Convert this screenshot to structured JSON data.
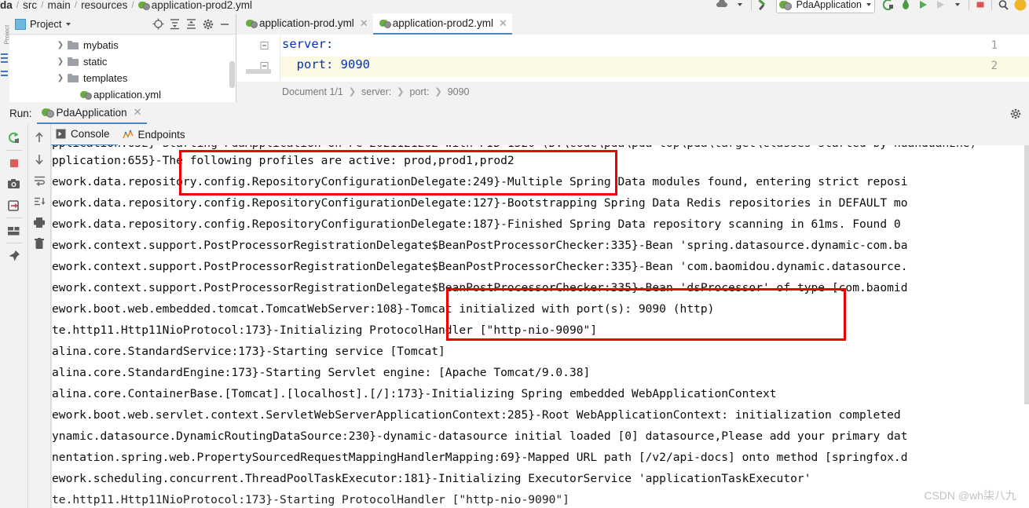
{
  "breadcrumb": {
    "items": [
      "da",
      "src",
      "main",
      "resources"
    ],
    "file": "application-prod2.yml"
  },
  "toolbar": {
    "run_config": "PdaApplication",
    "icons": [
      "cloud-upload-icon",
      "hammer-icon",
      "run-config-dropdown",
      "debug-attach-icon",
      "bug-icon",
      "run-icon",
      "debug-icon",
      "profile-dropdown-icon",
      "stop-icon",
      "search-icon",
      "avatar-icon"
    ]
  },
  "project_panel": {
    "title": "Project",
    "header_icons": [
      "locate-icon",
      "expand-all-icon",
      "collapse-all-icon",
      "settings-gear-icon",
      "hide-icon"
    ],
    "tree": [
      {
        "label": "mybatis",
        "type": "folder",
        "expandable": true
      },
      {
        "label": "static",
        "type": "folder",
        "expandable": true
      },
      {
        "label": "templates",
        "type": "folder",
        "expandable": true
      },
      {
        "label": "application.yml",
        "type": "yml",
        "expandable": false
      }
    ]
  },
  "editor": {
    "tabs": [
      {
        "label": "application-prod.yml",
        "active": false
      },
      {
        "label": "application-prod2.yml",
        "active": true
      }
    ],
    "lines": [
      {
        "num": "1",
        "text": "server:"
      },
      {
        "num": "2",
        "text": "  port: 9090"
      }
    ],
    "status_crumbs": [
      "Document 1/1",
      "server:",
      "port:",
      "9090"
    ]
  },
  "run_window": {
    "label": "Run:",
    "tab": "PdaApplication",
    "tabs": [
      {
        "label": "Console",
        "icon": "console-icon",
        "active": true
      },
      {
        "label": "Endpoints",
        "icon": "endpoints-icon",
        "active": false
      }
    ],
    "left_toolbar": [
      "rerun-icon",
      "stop-icon",
      "camera-icon",
      "export-icon",
      "layout-icon",
      "pin-icon"
    ],
    "left_toolbar2": [
      "scroll-up-icon",
      "scroll-down-icon",
      "soft-wrap-icon",
      "scroll-to-end-icon",
      "print-icon",
      "delete-icon"
    ],
    "settings_icon": "gear-icon"
  },
  "console": {
    "lines": [
      "pplication:655}-The following profiles are active: prod,prod1,prod2",
      "ework.data.repository.config.RepositoryConfigurationDelegate:249}-Multiple Spring Data modules found, entering strict reposi",
      "ework.data.repository.config.RepositoryConfigurationDelegate:127}-Bootstrapping Spring Data Redis repositories in DEFAULT mo",
      "ework.data.repository.config.RepositoryConfigurationDelegate:187}-Finished Spring Data repository scanning in 61ms. Found 0 ",
      "ework.context.support.PostProcessorRegistrationDelegate$BeanPostProcessorChecker:335}-Bean 'spring.datasource.dynamic-com.ba",
      "ework.context.support.PostProcessorRegistrationDelegate$BeanPostProcessorChecker:335}-Bean 'com.baomidou.dynamic.datasource.",
      "ework.context.support.PostProcessorRegistrationDelegate$BeanPostProcessorChecker:335}-Bean 'dsProcessor' of type [com.baomid",
      "ework.boot.web.embedded.tomcat.TomcatWebServer:108}-Tomcat initialized with port(s): 9090 (http)",
      "te.http11.Http11NioProtocol:173}-Initializing ProtocolHandler [\"http-nio-9090\"]",
      "alina.core.StandardService:173}-Starting service [Tomcat]",
      "alina.core.StandardEngine:173}-Starting Servlet engine: [Apache Tomcat/9.0.38]",
      "alina.core.ContainerBase.[Tomcat].[localhost].[/]:173}-Initializing Spring embedded WebApplicationContext",
      "ework.boot.web.servlet.context.ServletWebServerApplicationContext:285}-Root WebApplicationContext: initialization completed",
      "ynamic.datasource.DynamicRoutingDataSource:230}-dynamic-datasource initial loaded [0] datasource,Please add your primary dat",
      "nentation.spring.web.PropertySourcedRequestMappingHandlerMapping:69}-Mapped URL path [/v2/api-docs] onto method [springfox.d",
      "ework.scheduling.concurrent.ThreadPoolTaskExecutor:181}-Initializing ExecutorService 'applicationTaskExecutor'",
      "te.http11.Http11NioProtocol:173}-Starting ProtocolHandler [\"http-nio-9090\"]"
    ]
  },
  "annotations": [
    {
      "name": "profiles-highlight",
      "color": "#f10000"
    },
    {
      "name": "tomcat-port-highlight",
      "color": "#f10000"
    }
  ],
  "watermark": "CSDN @wh柒八九"
}
